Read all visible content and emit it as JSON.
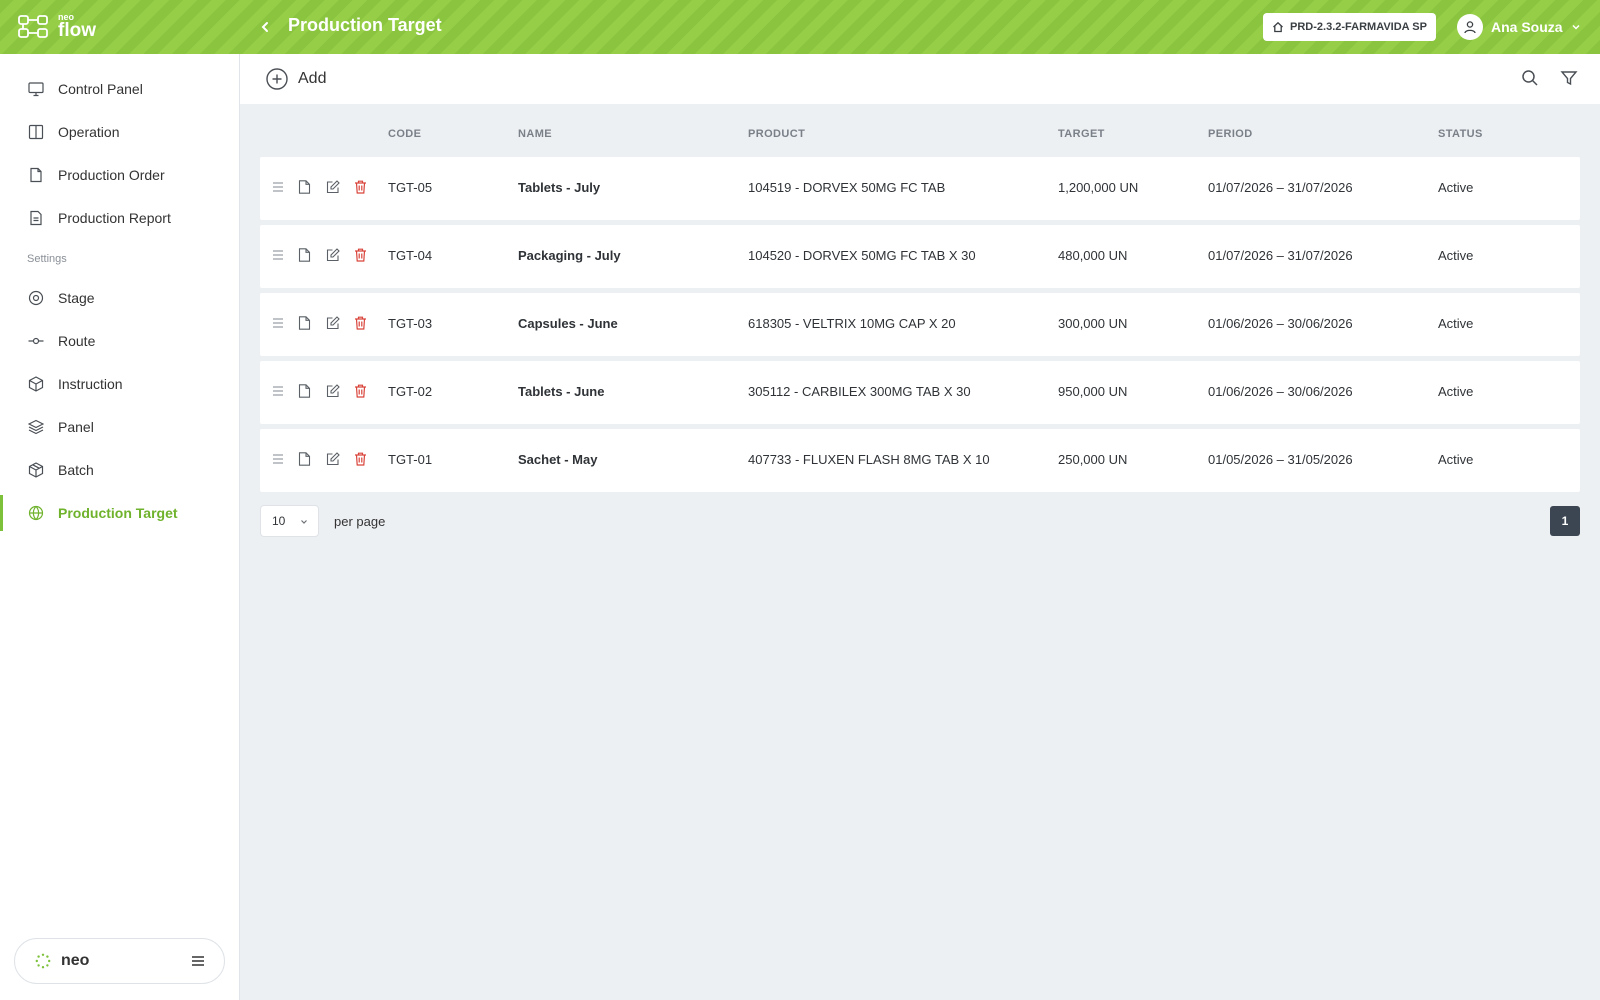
{
  "header": {
    "logo_small": "neo",
    "logo_big": "flow",
    "title": "Production Target",
    "environment": "PRD-2.3.2-FARMAVIDA SP",
    "user_name": "Ana Souza"
  },
  "sidebar": {
    "items": [
      {
        "label": "Control Panel",
        "icon": "monitor-icon"
      },
      {
        "label": "Operation",
        "icon": "columns-icon"
      },
      {
        "label": "Production Order",
        "icon": "file-icon"
      },
      {
        "label": "Production Report",
        "icon": "file-text-icon"
      }
    ],
    "section_label": "Settings",
    "settings_items": [
      {
        "label": "Stage",
        "icon": "target-icon"
      },
      {
        "label": "Route",
        "icon": "route-icon"
      },
      {
        "label": "Instruction",
        "icon": "cube-icon"
      },
      {
        "label": "Panel",
        "icon": "layers-icon"
      },
      {
        "label": "Batch",
        "icon": "box-icon"
      },
      {
        "label": "Production Target",
        "icon": "globe-icon",
        "active": true
      }
    ],
    "footer_label": "neo"
  },
  "toolbar": {
    "add_label": "Add"
  },
  "table": {
    "columns": [
      "CODE",
      "NAME",
      "PRODUCT",
      "TARGET",
      "PERIOD",
      "STATUS"
    ],
    "rows": [
      {
        "code": "TGT-05",
        "name": "Tablets - July",
        "product": "104519 - DORVEX 50MG FC TAB",
        "target": "1,200,000 UN",
        "period": "01/07/2026 – 31/07/2026",
        "status": "Active"
      },
      {
        "code": "TGT-04",
        "name": "Packaging - July",
        "product": "104520 - DORVEX 50MG FC TAB X 30",
        "target": "480,000 UN",
        "period": "01/07/2026 – 31/07/2026",
        "status": "Active"
      },
      {
        "code": "TGT-03",
        "name": "Capsules - June",
        "product": "618305 - VELTRIX 10MG CAP X 20",
        "target": "300,000 UN",
        "period": "01/06/2026 – 30/06/2026",
        "status": "Active"
      },
      {
        "code": "TGT-02",
        "name": "Tablets - June",
        "product": "305112 - CARBILEX 300MG TAB X 30",
        "target": "950,000 UN",
        "period": "01/06/2026 – 30/06/2026",
        "status": "Active"
      },
      {
        "code": "TGT-01",
        "name": "Sachet - May",
        "product": "407733 - FLUXEN FLASH 8MG TAB X 10",
        "target": "250,000 UN",
        "period": "01/05/2026 – 31/05/2026",
        "status": "Active"
      }
    ]
  },
  "pagination": {
    "per_page_value": "10",
    "per_page_label": "per page",
    "current_page": "1"
  },
  "colors": {
    "brand_green": "#8bc540",
    "active_green": "#6fb22c",
    "delete_red": "#d9433a",
    "page_active": "#3b4652"
  }
}
